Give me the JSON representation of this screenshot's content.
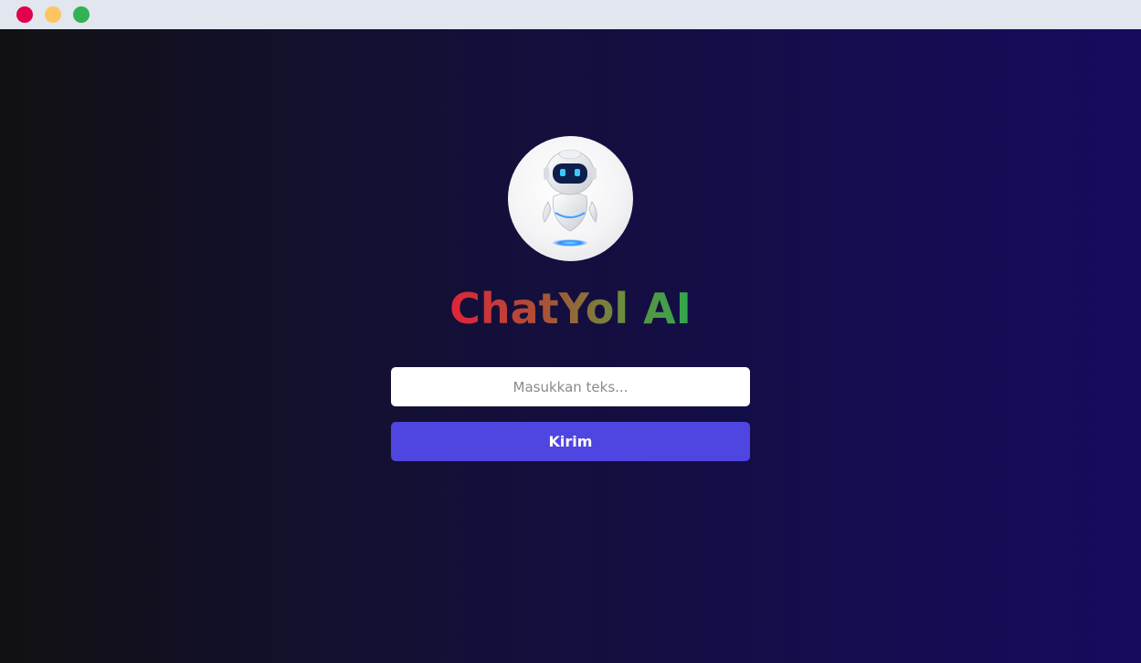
{
  "window": {
    "controls": [
      "close",
      "minimize",
      "maximize"
    ],
    "colors": {
      "close": "#e2004d",
      "minimize": "#fdc461",
      "maximize": "#32b253"
    }
  },
  "app": {
    "avatar_icon": "robot-icon",
    "title": "ChatYol AI",
    "title_gradient": [
      "#e0243a",
      "#a85437",
      "#6e8a3e",
      "#2fa84d"
    ]
  },
  "form": {
    "input_value": "",
    "input_placeholder": "Masukkan teks...",
    "submit_label": "Kirim",
    "submit_color": "#4f46e1"
  }
}
